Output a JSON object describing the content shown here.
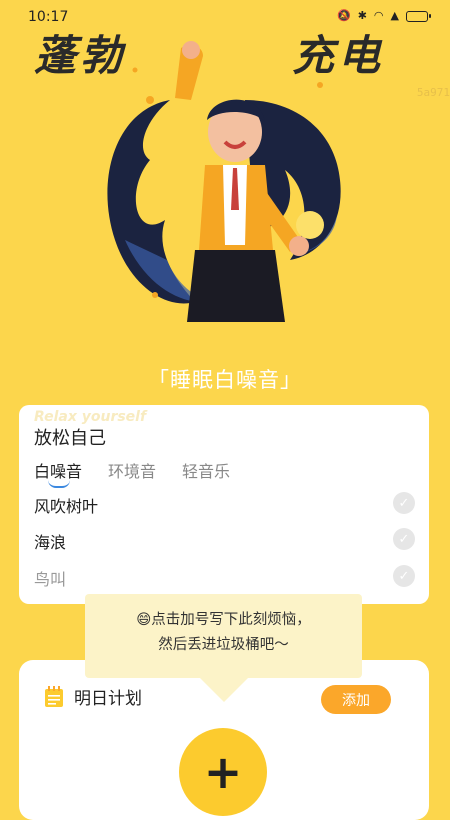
{
  "status_bar": {
    "time": "10:17"
  },
  "hero": {
    "title_left": "蓬勃",
    "title_right": "充电",
    "watermark": "5a971"
  },
  "relax": {
    "section_title": "「睡眠白噪音」",
    "card_bg_text": "Relax yourself",
    "card_title": "放松自己",
    "tabs": [
      "白噪音",
      "环境音",
      "轻音乐"
    ],
    "active_tab": "白噪音",
    "items": [
      "风吹树叶",
      "海浪",
      "鸟叫"
    ]
  },
  "tooltip": {
    "line1": "😄点击加号写下此刻烦恼，",
    "line2": "然后丢进垃圾桶吧～"
  },
  "plan": {
    "title": "明日计划",
    "add_label": "添加",
    "fab_symbol": "+"
  },
  "colors": {
    "background": "#FCD64C",
    "accent": "#FBA72A",
    "fab": "#FCCB2E",
    "tab_underline": "#3B88E0"
  }
}
